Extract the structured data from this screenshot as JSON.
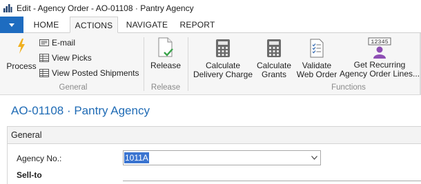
{
  "window": {
    "title": "Edit - Agency Order - AO-01108 · Pantry Agency"
  },
  "tabs": {
    "home": "HOME",
    "actions": "ACTIONS",
    "navigate": "NAVIGATE",
    "report": "REPORT"
  },
  "ribbon": {
    "general": {
      "label": "General",
      "process": "Process",
      "email": "E-mail",
      "view_picks": "View Picks",
      "view_posted_shipments": "View Posted Shipments"
    },
    "release": {
      "label": "Release",
      "release_button": "Release"
    },
    "functions": {
      "label": "Functions",
      "calc_delivery_line1": "Calculate",
      "calc_delivery_line2": "Delivery Charge",
      "calc_grants_line1": "Calculate",
      "calc_grants_line2": "Grants",
      "validate_line1": "Validate",
      "validate_line2": "Web Order",
      "recurring_line1": "Get Recurring",
      "recurring_line2": "Agency Order Lines...",
      "recurring_icon_text": "12345"
    }
  },
  "page": {
    "title": "AO-01108 · Pantry Agency",
    "section_general": "General",
    "agency_no_label": "Agency No.:",
    "agency_no_value": "1011A",
    "sell_to_label": "Sell-to"
  },
  "icons": {
    "app": "app-logo-icon",
    "process": "lightning-icon",
    "email": "envelope-icon",
    "view_picks": "table-grid-icon",
    "view_posted_shipments": "table-grid-icon",
    "release": "document-check-icon",
    "calculate": "calculator-icon",
    "validate": "checklist-document-icon",
    "recurring": "user-number-icon",
    "dropdown": "chevron-down-icon"
  },
  "colors": {
    "accent": "#1e6cc0",
    "title_blue": "#1f6bb5",
    "selection": "#3a74d0"
  }
}
